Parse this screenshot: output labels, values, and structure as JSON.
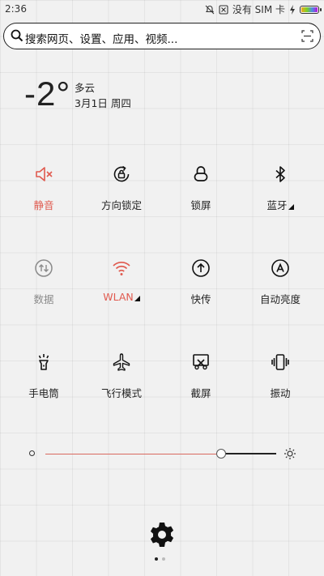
{
  "status_bar": {
    "time": "2:36",
    "carrier": "没有 SIM 卡",
    "icons": [
      "mute-icon",
      "notification-off-icon",
      "charging-icon",
      "battery-icon"
    ]
  },
  "search": {
    "placeholder": "搜索网页、设置、应用、视频..."
  },
  "weather": {
    "temperature": "-2°",
    "condition": "多云",
    "date": "3月1日 周四"
  },
  "toggles": [
    {
      "label": "静音",
      "icon": "speaker-mute-icon",
      "state": "active",
      "color": "#e05a4f"
    },
    {
      "label": "方向锁定",
      "icon": "rotation-lock-icon",
      "state": "off"
    },
    {
      "label": "锁屏",
      "icon": "lock-icon",
      "state": "off"
    },
    {
      "label": "蓝牙",
      "icon": "bluetooth-icon",
      "state": "off",
      "has_submenu": true
    },
    {
      "label": "数据",
      "icon": "mobile-data-icon",
      "state": "disabled",
      "color": "#8a8a8a"
    },
    {
      "label": "WLAN",
      "icon": "wifi-icon",
      "state": "active",
      "color": "#e05a4f",
      "has_submenu": true
    },
    {
      "label": "快传",
      "icon": "quick-transfer-icon",
      "state": "off"
    },
    {
      "label": "自动亮度",
      "icon": "auto-brightness-icon",
      "state": "off"
    },
    {
      "label": "手电筒",
      "icon": "flashlight-icon",
      "state": "off"
    },
    {
      "label": "飞行模式",
      "icon": "airplane-icon",
      "state": "off"
    },
    {
      "label": "截屏",
      "icon": "screenshot-icon",
      "state": "off"
    },
    {
      "label": "振动",
      "icon": "vibrate-icon",
      "state": "off"
    }
  ],
  "brightness": {
    "level": 0.76,
    "accent": "#d9695f"
  },
  "pager": {
    "current": 1,
    "total": 2
  }
}
